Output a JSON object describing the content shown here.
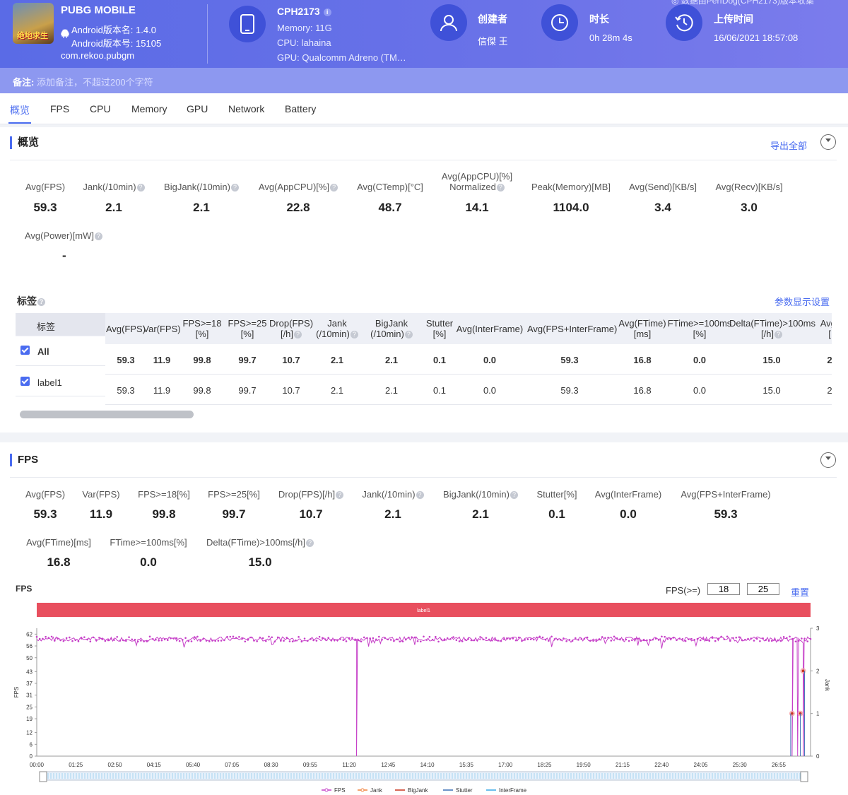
{
  "header": {
    "app_name": "PUBG MOBILE",
    "icon_text": "绝地求生",
    "android_version_name": "Android版本名: 1.4.0",
    "android_version_code": "Android版本号: 15105",
    "package": "com.rekoo.pubgm",
    "device_name": "CPH2173",
    "memory": "Memory: 11G",
    "cpu": "CPU: lahaina",
    "gpu": "GPU: Qualcomm Adreno (TM…",
    "creator_label": "创建者",
    "creator_value": "信傑 王",
    "duration_label": "时长",
    "duration_value": "0h 28m 4s",
    "upload_label": "上传时间",
    "upload_value": "16/06/2021 18:57:08",
    "top_note": "◎ 数据由PerfDog(CPH2173)版本收集"
  },
  "remark": {
    "label": "备注:",
    "placeholder": "添加备注，不超过200个字符"
  },
  "tabs": [
    "概览",
    "FPS",
    "CPU",
    "Memory",
    "GPU",
    "Network",
    "Battery"
  ],
  "overview": {
    "title": "概览",
    "export": "导出全部",
    "metrics": [
      {
        "label": "Avg(FPS)",
        "value": "59.3",
        "help": false
      },
      {
        "label": "Jank(/10min)",
        "value": "2.1",
        "help": true
      },
      {
        "label": "BigJank(/10min)",
        "value": "2.1",
        "help": true
      },
      {
        "label": "Avg(AppCPU)[%]",
        "value": "22.8",
        "help": true
      },
      {
        "label": "Avg(CTemp)[°C]",
        "value": "48.7",
        "help": false
      },
      {
        "label": "Avg(AppCPU)[%]",
        "label2": "Normalized",
        "value": "14.1",
        "help": true
      },
      {
        "label": "Peak(Memory)[MB]",
        "value": "1104.0",
        "help": false
      },
      {
        "label": "Avg(Send)[KB/s]",
        "value": "3.4",
        "help": false
      },
      {
        "label": "Avg(Recv)[KB/s]",
        "value": "3.0",
        "help": false
      }
    ],
    "power": {
      "label": "Avg(Power)[mW]",
      "value": "-"
    }
  },
  "labels": {
    "title": "标签",
    "settings": "参数显示设置",
    "col0": "标签",
    "columns": [
      {
        "l1": "Avg(FPS)",
        "l2": ""
      },
      {
        "l1": "Var(FPS)",
        "l2": ""
      },
      {
        "l1": "FPS>=18",
        "l2": "[%]"
      },
      {
        "l1": "FPS>=25",
        "l2": "[%]"
      },
      {
        "l1": "Drop(FPS)",
        "l2": "[/h]"
      },
      {
        "l1": "Jank",
        "l2": "(/10min)"
      },
      {
        "l1": "BigJank",
        "l2": "(/10min)"
      },
      {
        "l1": "Stutter",
        "l2": "[%]"
      },
      {
        "l1": "Avg(InterFrame)",
        "l2": ""
      },
      {
        "l1": "Avg(FPS+InterFrame)",
        "l2": ""
      },
      {
        "l1": "Avg(FTime)",
        "l2": "[ms]"
      },
      {
        "l1": "FTime>=100ms",
        "l2": "[%]"
      },
      {
        "l1": "Delta(FTime)>100ms",
        "l2": "[/h]"
      },
      {
        "l1": "Avg(",
        "l2": "["
      }
    ],
    "rows": [
      {
        "name": "All",
        "values": [
          "59.3",
          "11.9",
          "99.8",
          "99.7",
          "10.7",
          "2.1",
          "2.1",
          "0.1",
          "0.0",
          "59.3",
          "16.8",
          "0.0",
          "15.0",
          "2"
        ]
      },
      {
        "name": "label1",
        "values": [
          "59.3",
          "11.9",
          "99.8",
          "99.7",
          "10.7",
          "2.1",
          "2.1",
          "0.1",
          "0.0",
          "59.3",
          "16.8",
          "0.0",
          "15.0",
          "2"
        ]
      }
    ]
  },
  "fps_section": {
    "title": "FPS",
    "metrics": [
      {
        "label": "Avg(FPS)",
        "value": "59.3",
        "help": false
      },
      {
        "label": "Var(FPS)",
        "value": "11.9",
        "help": false
      },
      {
        "label": "FPS>=18[%]",
        "value": "99.8",
        "help": false
      },
      {
        "label": "FPS>=25[%]",
        "value": "99.7",
        "help": false
      },
      {
        "label": "Drop(FPS)[/h]",
        "value": "10.7",
        "help": true
      },
      {
        "label": "Jank(/10min)",
        "value": "2.1",
        "help": true
      },
      {
        "label": "BigJank(/10min)",
        "value": "2.1",
        "help": true
      },
      {
        "label": "Stutter[%]",
        "value": "0.1",
        "help": false
      },
      {
        "label": "Avg(InterFrame)",
        "value": "0.0",
        "help": false
      },
      {
        "label": "Avg(FPS+InterFrame)",
        "value": "59.3",
        "help": false
      }
    ],
    "metrics2": [
      {
        "label": "Avg(FTime)[ms]",
        "value": "16.8",
        "help": false
      },
      {
        "label": "FTime>=100ms[%]",
        "value": "0.0",
        "help": false
      },
      {
        "label": "Delta(FTime)>100ms[/h]",
        "value": "15.0",
        "help": true
      }
    ],
    "chart_title": "FPS",
    "fps_ge_label": "FPS(>=)",
    "fps_ge_1": "18",
    "fps_ge_2": "25",
    "reset": "重置",
    "band_label": "label1"
  },
  "colors": {
    "accent": "#4a6cf0",
    "fps": "#c640c8",
    "jank": "#f0823c",
    "bigjank": "#c8341e",
    "stutter": "#3b6fb6",
    "interframe": "#39a8e6",
    "band": "#e84f5e"
  },
  "chart_data": {
    "type": "line",
    "title": "FPS",
    "ylabel": "FPS",
    "y2label": "Jank",
    "yticks": [
      0,
      6,
      12,
      19,
      25,
      31,
      37,
      43,
      50,
      56,
      62
    ],
    "y2ticks": [
      0,
      1,
      2,
      3
    ],
    "ylim": [
      0,
      65
    ],
    "y2lim": [
      0,
      3
    ],
    "xticks": [
      "00:00",
      "01:25",
      "02:50",
      "04:15",
      "05:40",
      "07:05",
      "08:30",
      "09:55",
      "11:20",
      "12:45",
      "14:10",
      "15:35",
      "17:00",
      "18:25",
      "19:50",
      "21:15",
      "22:40",
      "24:05",
      "25:30",
      "26:55"
    ],
    "x_range_minutes": [
      0,
      28.07
    ],
    "series": [
      {
        "name": "FPS",
        "baseline": 59.5,
        "drops": [
          {
            "t": 11.6,
            "value": 0
          },
          {
            "t": 27.4,
            "value": 0
          },
          {
            "t": 27.6,
            "value": 0
          },
          {
            "t": 27.8,
            "value": 0
          }
        ]
      },
      {
        "name": "Jank",
        "points": [
          {
            "t": 27.4,
            "value": 1
          },
          {
            "t": 27.7,
            "value": 1
          },
          {
            "t": 27.8,
            "value": 2
          }
        ]
      },
      {
        "name": "BigJank",
        "points": [
          {
            "t": 27.4,
            "value": 1
          },
          {
            "t": 27.7,
            "value": 1
          },
          {
            "t": 27.8,
            "value": 2
          }
        ]
      },
      {
        "name": "Stutter",
        "points": []
      },
      {
        "name": "InterFrame",
        "points": []
      }
    ],
    "legend": [
      "FPS",
      "Jank",
      "BigJank",
      "Stutter",
      "InterFrame"
    ],
    "legend_position": "bottom"
  }
}
